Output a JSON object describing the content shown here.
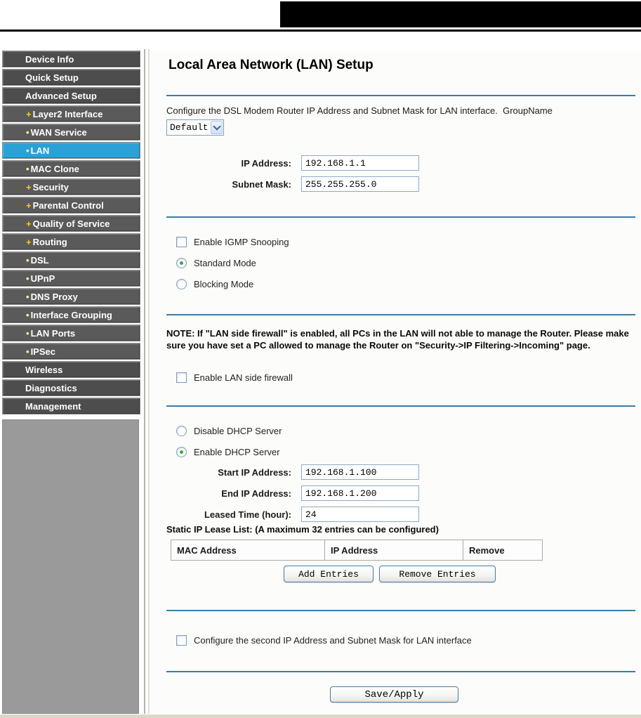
{
  "sidebar": {
    "items": [
      {
        "label": "Device Info",
        "bullet": ""
      },
      {
        "label": "Quick Setup",
        "bullet": ""
      },
      {
        "label": "Advanced Setup",
        "bullet": ""
      },
      {
        "label": "Layer2 Interface",
        "bullet": "+"
      },
      {
        "label": "WAN Service",
        "bullet": "•"
      },
      {
        "label": "LAN",
        "bullet": "•"
      },
      {
        "label": "MAC Clone",
        "bullet": "•"
      },
      {
        "label": "Security",
        "bullet": "+"
      },
      {
        "label": "Parental Control",
        "bullet": "+"
      },
      {
        "label": "Quality of Service",
        "bullet": "+"
      },
      {
        "label": "Routing",
        "bullet": "+"
      },
      {
        "label": "DSL",
        "bullet": "•"
      },
      {
        "label": "UPnP",
        "bullet": "•"
      },
      {
        "label": "DNS Proxy",
        "bullet": "•"
      },
      {
        "label": "Interface Grouping",
        "bullet": "•"
      },
      {
        "label": "LAN Ports",
        "bullet": "•"
      },
      {
        "label": "IPSec",
        "bullet": "•"
      },
      {
        "label": "Wireless",
        "bullet": ""
      },
      {
        "label": "Diagnostics",
        "bullet": ""
      },
      {
        "label": "Management",
        "bullet": ""
      }
    ],
    "selected_item": "LAN"
  },
  "main": {
    "title": "Local Area Network (LAN) Setup",
    "intro": "Configure the DSL Modem Router IP Address and Subnet Mask for LAN interface.",
    "group_name_label": "GroupName",
    "group_select_value": "Default",
    "ip_address": {
      "label": "IP Address:",
      "value": "192.168.1.1"
    },
    "subnet_mask": {
      "label": "Subnet Mask:",
      "value": "255.255.255.0"
    },
    "igmp_checkbox_label": "Enable IGMP Snooping",
    "standard_mode_label": "Standard Mode",
    "blocking_mode_label": "Blocking Mode",
    "note": "NOTE: If \"LAN side firewall\" is enabled, all PCs in the LAN will not able to manage the Router. Please make sure you have set a PC allowed to manage the Router on \"Security->IP Filtering->Incoming\" page.",
    "lan_firewall_checkbox_label": "Enable LAN side firewall",
    "dhcp": {
      "disable_label": "Disable DHCP Server",
      "enable_label": "Enable DHCP Server",
      "start_ip": {
        "label": "Start IP Address:",
        "value": "192.168.1.100"
      },
      "end_ip": {
        "label": "End IP Address:",
        "value": "192.168.1.200"
      },
      "lease_time": {
        "label": "Leased Time (hour):",
        "value": "24"
      }
    },
    "static_lease": {
      "caption": "Static IP Lease List: (A maximum 32 entries can be configured)",
      "headers": [
        "MAC Address",
        "IP Address",
        "Remove"
      ],
      "rows": []
    },
    "buttons": {
      "add_entries": "Add Entries",
      "remove_entries": "Remove Entries",
      "save_apply": "Save/Apply"
    },
    "second_ip_checkbox_label": "Configure the second IP Address and Subnet Mask for LAN interface"
  },
  "form_state": {
    "igmp_snooping_checked": false,
    "mode_selected": "Standard Mode",
    "lan_firewall_checked": false,
    "dhcp_selected": "Enable DHCP Server",
    "second_ip_checked": false
  },
  "colors": {
    "sidebar_selected_bg": "#2aa2d8",
    "sidebar_item_bg": "#5a5a5a",
    "separator_blue": "#3d7ca4",
    "bullet_plus": "#ffd000",
    "bullet_dot": "#fff3a0"
  }
}
